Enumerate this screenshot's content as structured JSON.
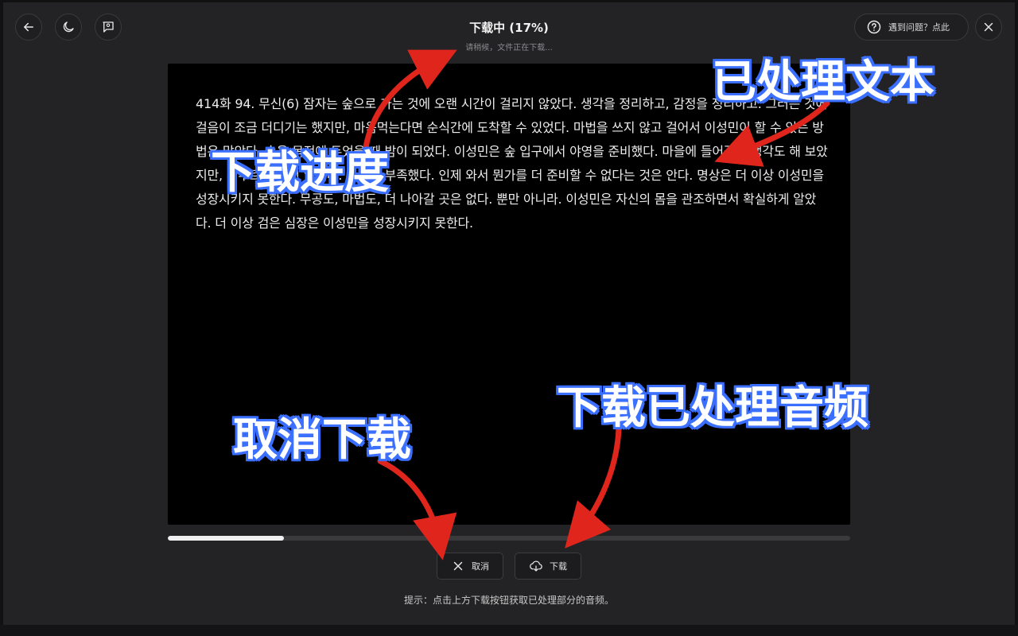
{
  "header": {
    "title": "下载中 (17%)",
    "subtitle": "请稍候，文件正在下载...",
    "help_label": "遇到问题？点此"
  },
  "icons": {
    "back": "arrow-left-icon",
    "theme": "moon-icon",
    "feedback": "message-square-icon",
    "help": "help-circle-icon",
    "close": "close-icon",
    "cancel": "x-icon",
    "download": "cloud-download-icon"
  },
  "content": {
    "text": "414화 94. 무신(6) 잠자는 숲으로 가는 것에 오랜 시간이 걸리지 않았다. 생각을 정리하고, 감정을 정리하고. 그러는 것에 걸음이 조금 더디기는 했지만, 마음먹는다면 순식간에 도착할 수 있었다. 마법을 쓰지 않고 걸어서 이성민이 할 수 있는 방법은 많았다. 숲을 목전에 두었을 때 밤이 되었다. 이성민은 숲 입구에서 야영을 준비했다. 마을에 들어갈까 생각도 해 보았지만, 서두르고 싶지 않았다. 확신이 부족했다. 인제 와서 뭔가를 더 준비할 수 없다는 것은 안다. 명상은 더 이상 이성민을 성장시키지 못한다. 무공도, 마법도, 더 나아갈 곳은 없다. 뿐만 아니라. 이성민은 자신의 몸을 관조하면서 확실하게 알았다. 더 이상 검은 심장은 이성민을 성장시키지 못한다."
  },
  "progress": {
    "value": 0.17
  },
  "actions": {
    "cancel_label": "取消",
    "download_label": "下载"
  },
  "hint": "提示：点击上方下载按钮获取已处理部分的音频。",
  "annotations": {
    "processed_text": "已处理文本",
    "download_progress": "下载进度",
    "cancel_download": "取消下载",
    "download_processed_audio": "下载已处理音频"
  },
  "colors": {
    "background": "#232325",
    "panel": "#000000",
    "annotation_outline": "#3b6fff",
    "arrow": "#e0261c"
  }
}
